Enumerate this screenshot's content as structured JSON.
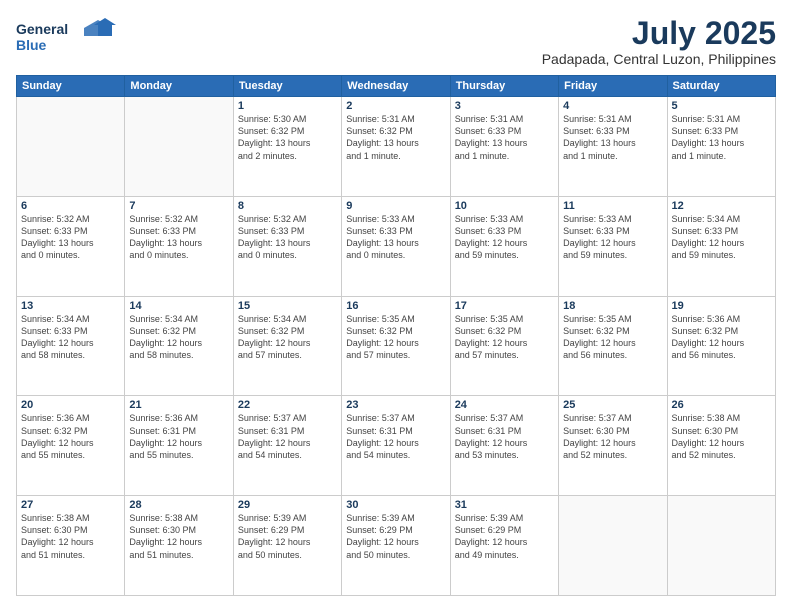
{
  "logo": {
    "line1": "General",
    "line2": "Blue"
  },
  "title": "July 2025",
  "subtitle": "Padapada, Central Luzon, Philippines",
  "weekdays": [
    "Sunday",
    "Monday",
    "Tuesday",
    "Wednesday",
    "Thursday",
    "Friday",
    "Saturday"
  ],
  "weeks": [
    [
      {
        "day": "",
        "detail": ""
      },
      {
        "day": "",
        "detail": ""
      },
      {
        "day": "1",
        "detail": "Sunrise: 5:30 AM\nSunset: 6:32 PM\nDaylight: 13 hours\nand 2 minutes."
      },
      {
        "day": "2",
        "detail": "Sunrise: 5:31 AM\nSunset: 6:32 PM\nDaylight: 13 hours\nand 1 minute."
      },
      {
        "day": "3",
        "detail": "Sunrise: 5:31 AM\nSunset: 6:33 PM\nDaylight: 13 hours\nand 1 minute."
      },
      {
        "day": "4",
        "detail": "Sunrise: 5:31 AM\nSunset: 6:33 PM\nDaylight: 13 hours\nand 1 minute."
      },
      {
        "day": "5",
        "detail": "Sunrise: 5:31 AM\nSunset: 6:33 PM\nDaylight: 13 hours\nand 1 minute."
      }
    ],
    [
      {
        "day": "6",
        "detail": "Sunrise: 5:32 AM\nSunset: 6:33 PM\nDaylight: 13 hours\nand 0 minutes."
      },
      {
        "day": "7",
        "detail": "Sunrise: 5:32 AM\nSunset: 6:33 PM\nDaylight: 13 hours\nand 0 minutes."
      },
      {
        "day": "8",
        "detail": "Sunrise: 5:32 AM\nSunset: 6:33 PM\nDaylight: 13 hours\nand 0 minutes."
      },
      {
        "day": "9",
        "detail": "Sunrise: 5:33 AM\nSunset: 6:33 PM\nDaylight: 13 hours\nand 0 minutes."
      },
      {
        "day": "10",
        "detail": "Sunrise: 5:33 AM\nSunset: 6:33 PM\nDaylight: 12 hours\nand 59 minutes."
      },
      {
        "day": "11",
        "detail": "Sunrise: 5:33 AM\nSunset: 6:33 PM\nDaylight: 12 hours\nand 59 minutes."
      },
      {
        "day": "12",
        "detail": "Sunrise: 5:34 AM\nSunset: 6:33 PM\nDaylight: 12 hours\nand 59 minutes."
      }
    ],
    [
      {
        "day": "13",
        "detail": "Sunrise: 5:34 AM\nSunset: 6:33 PM\nDaylight: 12 hours\nand 58 minutes."
      },
      {
        "day": "14",
        "detail": "Sunrise: 5:34 AM\nSunset: 6:32 PM\nDaylight: 12 hours\nand 58 minutes."
      },
      {
        "day": "15",
        "detail": "Sunrise: 5:34 AM\nSunset: 6:32 PM\nDaylight: 12 hours\nand 57 minutes."
      },
      {
        "day": "16",
        "detail": "Sunrise: 5:35 AM\nSunset: 6:32 PM\nDaylight: 12 hours\nand 57 minutes."
      },
      {
        "day": "17",
        "detail": "Sunrise: 5:35 AM\nSunset: 6:32 PM\nDaylight: 12 hours\nand 57 minutes."
      },
      {
        "day": "18",
        "detail": "Sunrise: 5:35 AM\nSunset: 6:32 PM\nDaylight: 12 hours\nand 56 minutes."
      },
      {
        "day": "19",
        "detail": "Sunrise: 5:36 AM\nSunset: 6:32 PM\nDaylight: 12 hours\nand 56 minutes."
      }
    ],
    [
      {
        "day": "20",
        "detail": "Sunrise: 5:36 AM\nSunset: 6:32 PM\nDaylight: 12 hours\nand 55 minutes."
      },
      {
        "day": "21",
        "detail": "Sunrise: 5:36 AM\nSunset: 6:31 PM\nDaylight: 12 hours\nand 55 minutes."
      },
      {
        "day": "22",
        "detail": "Sunrise: 5:37 AM\nSunset: 6:31 PM\nDaylight: 12 hours\nand 54 minutes."
      },
      {
        "day": "23",
        "detail": "Sunrise: 5:37 AM\nSunset: 6:31 PM\nDaylight: 12 hours\nand 54 minutes."
      },
      {
        "day": "24",
        "detail": "Sunrise: 5:37 AM\nSunset: 6:31 PM\nDaylight: 12 hours\nand 53 minutes."
      },
      {
        "day": "25",
        "detail": "Sunrise: 5:37 AM\nSunset: 6:30 PM\nDaylight: 12 hours\nand 52 minutes."
      },
      {
        "day": "26",
        "detail": "Sunrise: 5:38 AM\nSunset: 6:30 PM\nDaylight: 12 hours\nand 52 minutes."
      }
    ],
    [
      {
        "day": "27",
        "detail": "Sunrise: 5:38 AM\nSunset: 6:30 PM\nDaylight: 12 hours\nand 51 minutes."
      },
      {
        "day": "28",
        "detail": "Sunrise: 5:38 AM\nSunset: 6:30 PM\nDaylight: 12 hours\nand 51 minutes."
      },
      {
        "day": "29",
        "detail": "Sunrise: 5:39 AM\nSunset: 6:29 PM\nDaylight: 12 hours\nand 50 minutes."
      },
      {
        "day": "30",
        "detail": "Sunrise: 5:39 AM\nSunset: 6:29 PM\nDaylight: 12 hours\nand 50 minutes."
      },
      {
        "day": "31",
        "detail": "Sunrise: 5:39 AM\nSunset: 6:29 PM\nDaylight: 12 hours\nand 49 minutes."
      },
      {
        "day": "",
        "detail": ""
      },
      {
        "day": "",
        "detail": ""
      }
    ]
  ]
}
